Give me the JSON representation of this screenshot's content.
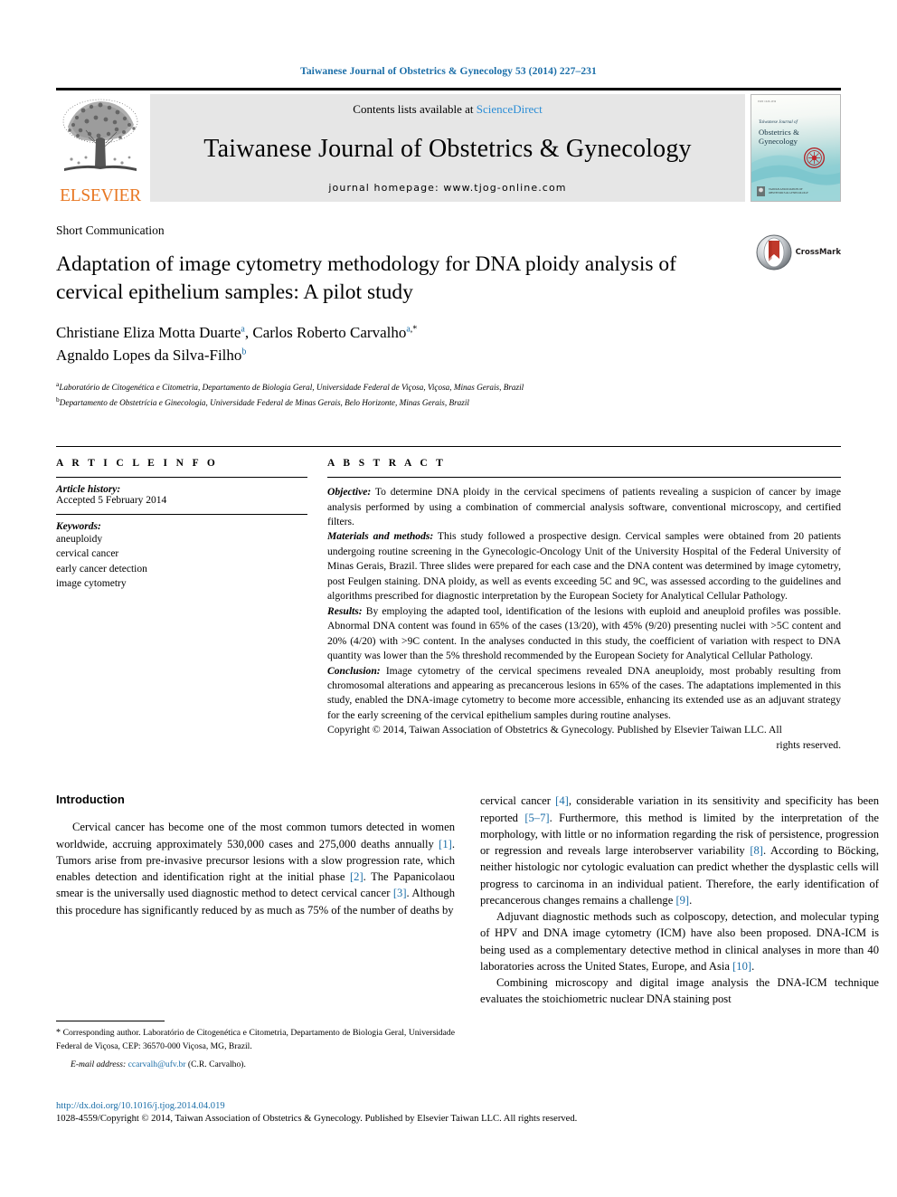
{
  "running_head": "Taiwanese Journal of Obstetrics & Gynecology 53 (2014) 227–231",
  "masthead": {
    "publisher_logo_text": "ELSEVIER",
    "contents_prefix": "Contents lists available at",
    "contents_link": "ScienceDirect",
    "journal_title": "Taiwanese Journal of Obstetrics & Gynecology",
    "homepage_label": "journal homepage: www.tjog-online.com",
    "cover": {
      "tiny_top": "ISSN 1028-4559",
      "italic_line": "Taiwanese Journal of",
      "name": "Obstetrics & Gynecology",
      "footer_line1": "TAIWAN ASSOCIATION OF",
      "footer_line2": "OBSTETRICS & GYNECOLOGY"
    }
  },
  "article": {
    "type": "Short Communication",
    "title": "Adaptation of image cytometry methodology for DNA ploidy analysis of cervical epithelium samples: A pilot study",
    "authors_line1_a": "Christiane Eliza Motta Duarte",
    "authors_sup1": "a",
    "authors_line1_b": ", Carlos Roberto Carvalho",
    "authors_sup2": "a",
    "authors_sup2b": ",*",
    "authors_line2": "Agnaldo Lopes da Silva-Filho",
    "authors_sup3": "b",
    "affiliations": [
      {
        "marker": "a",
        "text": "Laboratório de Citogenética e Citometria, Departamento de Biologia Geral, Universidade Federal de Viçosa, Viçosa, Minas Gerais, Brazil"
      },
      {
        "marker": "b",
        "text": "Departamento de Obstetrícia e Ginecologia, Universidade Federal de Minas Gerais, Belo Horizonte, Minas Gerais, Brazil"
      }
    ],
    "crossmark_label": "CrossMark"
  },
  "article_info": {
    "heading": "A R T I C L E  I N F O",
    "history_label": "Article history:",
    "history_value": "Accepted 5 February 2014",
    "keywords_label": "Keywords:",
    "keywords": [
      "aneuploidy",
      "cervical cancer",
      "early cancer detection",
      "image cytometry"
    ]
  },
  "abstract": {
    "heading": "A B S T R A C T",
    "sections": [
      {
        "label": "Objective:",
        "text": " To determine DNA ploidy in the cervical specimens of patients revealing a suspicion of cancer by image analysis performed by using a combination of commercial analysis software, conventional microscopy, and certified filters."
      },
      {
        "label": "Materials and methods:",
        "text": " This study followed a prospective design. Cervical samples were obtained from 20 patients undergoing routine screening in the Gynecologic-Oncology Unit of the University Hospital of the Federal University of Minas Gerais, Brazil. Three slides were prepared for each case and the DNA content was determined by image cytometry, post Feulgen staining. DNA ploidy, as well as events exceeding 5C and 9C, was assessed according to the guidelines and algorithms prescribed for diagnostic interpretation by the European Society for Analytical Cellular Pathology."
      },
      {
        "label": "Results:",
        "text": " By employing the adapted tool, identification of the lesions with euploid and aneuploid profiles was possible. Abnormal DNA content was found in 65% of the cases (13/20), with 45% (9/20) presenting nuclei with >5C content and 20% (4/20) with >9C content. In the analyses conducted in this study, the coefficient of variation with respect to DNA quantity was lower than the 5% threshold recommended by the European Society for Analytical Cellular Pathology."
      },
      {
        "label": "Conclusion:",
        "text": " Image cytometry of the cervical specimens revealed DNA aneuploidy, most probably resulting from chromosomal alterations and appearing as precancerous lesions in 65% of the cases. The adaptations implemented in this study, enabled the DNA-image cytometry to become more accessible, enhancing its extended use as an adjuvant strategy for the early screening of the cervical epithelium samples during routine analyses."
      }
    ],
    "copyright": "Copyright © 2014, Taiwan Association of Obstetrics & Gynecology. Published by Elsevier Taiwan LLC. All",
    "copyright_tail": "rights reserved."
  },
  "body": {
    "intro_heading": "Introduction",
    "left_para_1_a": "Cervical cancer has become one of the most common tumors detected in women worldwide, accruing approximately 530,000 cases and 275,000 deaths annually ",
    "left_ref_1": "[1]",
    "left_para_1_b": ". Tumors arise from pre-invasive precursor lesions with a slow progression rate, which enables detection and identification right at the initial phase ",
    "left_ref_2": "[2]",
    "left_para_1_c": ". The Papanicolaou smear is the universally used diagnostic method to detect cervical cancer ",
    "left_ref_3": "[3]",
    "left_para_1_d": ". Although this procedure has significantly reduced by as much as 75% of the number of deaths by",
    "right_para_1_a": "cervical cancer ",
    "right_ref_4": "[4]",
    "right_para_1_b": ", considerable variation in its sensitivity and specificity has been reported ",
    "right_ref_5": "[5–7]",
    "right_para_1_c": ". Furthermore, this method is limited by the interpretation of the morphology, with little or no information regarding the risk of persistence, progression or regression and reveals large interobserver variability ",
    "right_ref_8": "[8]",
    "right_para_1_d": ". According to Böcking, neither histologic nor cytologic evaluation can predict whether the dysplastic cells will progress to carcinoma in an individual patient. Therefore, the early identification of precancerous changes remains a challenge ",
    "right_ref_9": "[9]",
    "right_para_1_e": ".",
    "right_para_2_a": "Adjuvant diagnostic methods such as colposcopy, detection, and molecular typing of HPV and DNA image cytometry (ICM) have also been proposed. DNA-ICM is being used as a complementary detective method in clinical analyses in more than 40 laboratories across the United States, Europe, and Asia ",
    "right_ref_10": "[10]",
    "right_para_2_b": ".",
    "right_para_3": "Combining microscopy and digital image analysis the DNA-ICM technique evaluates the stoichiometric nuclear DNA staining post"
  },
  "footnote": {
    "star": "*",
    "text": " Corresponding author. Laboratório de Citogenética e Citometria, Departamento de Biologia Geral, Universidade Federal de Viçosa, CEP: 36570-000 Viçosa, MG, Brazil.",
    "email_label": "E-mail address:",
    "email": "ccarvalh@ufv.br",
    "email_owner": "(C.R. Carvalho)."
  },
  "page_footer": {
    "doi": "http://dx.doi.org/10.1016/j.tjog.2014.04.019",
    "issn_line": "1028-4559/Copyright © 2014, Taiwan Association of Obstetrics & Gynecology. Published by Elsevier Taiwan LLC. All rights reserved."
  },
  "colors": {
    "link": "#1b6ea8",
    "elsevier_orange": "#E87722",
    "sciencedirect_blue": "#2b8dd6",
    "banner_gray": "#e6e6e6"
  }
}
